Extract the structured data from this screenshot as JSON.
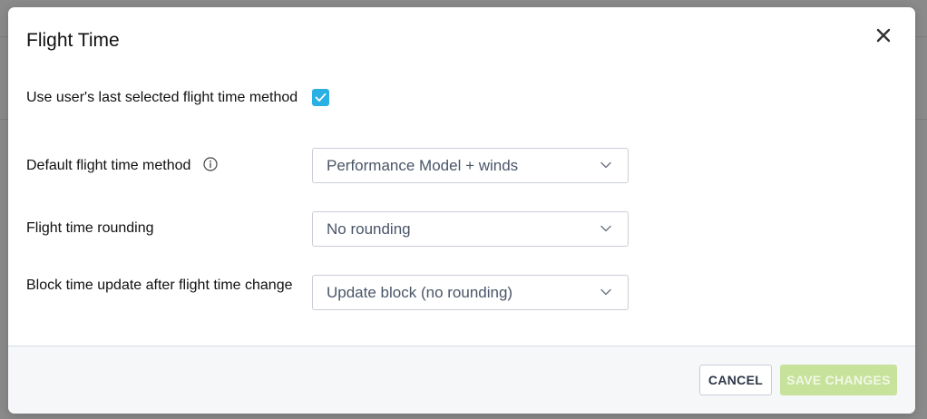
{
  "dialog": {
    "title": "Flight Time"
  },
  "settings": {
    "last_selected": {
      "label": "Use user's last selected flight time method",
      "checked": true
    },
    "default_method": {
      "label": "Default flight time method",
      "value": "Performance Model + winds"
    },
    "rounding": {
      "label": "Flight time rounding",
      "value": "No rounding"
    },
    "block_update": {
      "label": "Block time update after flight time change",
      "value": "Update block (no rounding)"
    }
  },
  "footer": {
    "cancel_label": "CANCEL",
    "save_label": "SAVE CHANGES"
  },
  "colors": {
    "checkbox": "#2bb0e4",
    "save_button": "#c6e29b",
    "overlay": "#8a8a8a"
  },
  "icons": {
    "close": "close-icon",
    "info": "info-icon",
    "check": "checkmark-icon",
    "dropdown": "chevron-down-icon"
  }
}
